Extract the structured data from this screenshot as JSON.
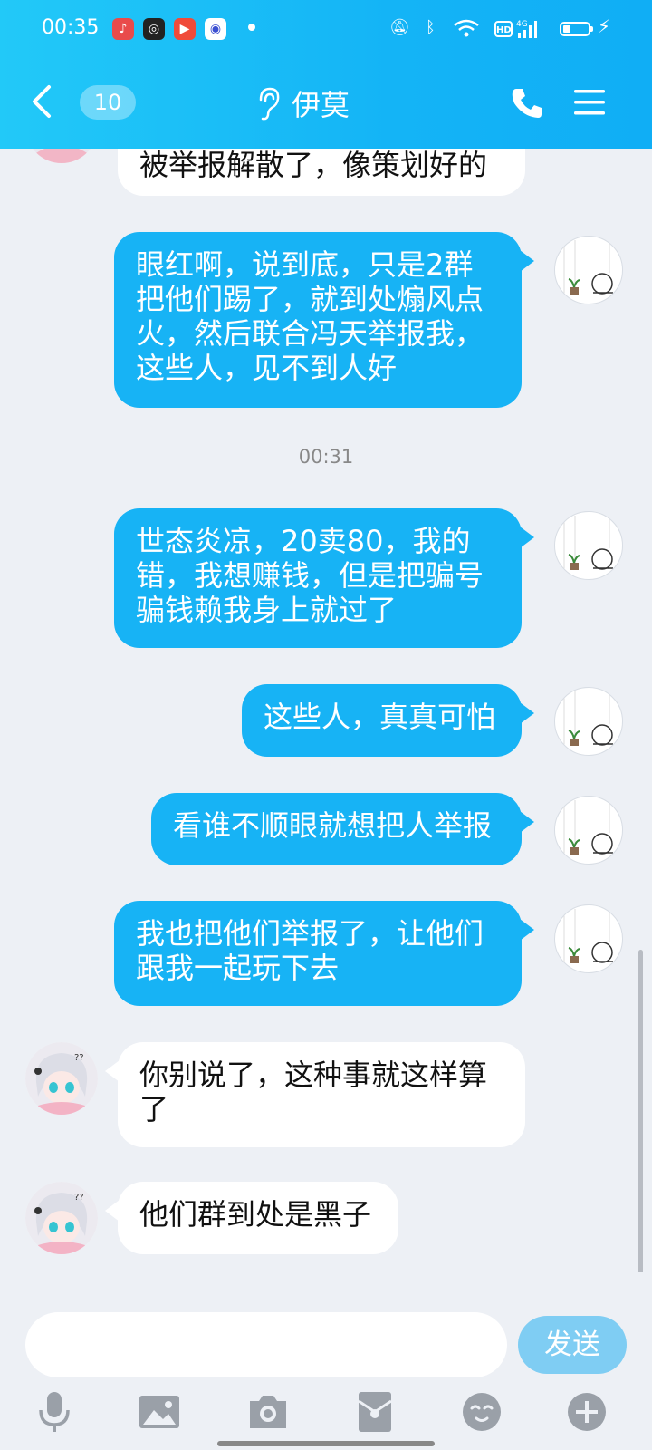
{
  "status_bar": {
    "time": "00:35",
    "network_label": "4G",
    "hd_label": "HD"
  },
  "header": {
    "unread_count": "10",
    "title": "伊莫"
  },
  "messages": [
    {
      "side": "in",
      "text": "被举报解散了，像策划好的"
    },
    {
      "side": "out",
      "text": "眼红啊，说到底，只是2群把他们踢了，就到处煽风点火，然后联合冯天举报我，这些人，见不到人好"
    },
    {
      "side": "time",
      "text": "00:31"
    },
    {
      "side": "out",
      "text": "世态炎凉，20卖80，我的错，我想赚钱，但是把骗号骗钱赖我身上就过了"
    },
    {
      "side": "out",
      "text": "这些人，真真可怕"
    },
    {
      "side": "out",
      "text": "看谁不顺眼就想把人举报"
    },
    {
      "side": "out",
      "text": "我也把他们举报了，让他们跟我一起玩下去"
    },
    {
      "side": "in",
      "text": "你别说了，这种事就这样算了"
    },
    {
      "side": "in",
      "text": "他们群到处是黑子"
    }
  ],
  "input": {
    "value": "",
    "send_label": "发送"
  },
  "toolbar": [
    "microphone-icon",
    "image-icon",
    "camera-icon",
    "red-packet-icon",
    "emoji-icon",
    "plus-icon"
  ],
  "colors": {
    "header": "#14b4f6",
    "outgoing_bubble": "#17b3f5",
    "incoming_bubble": "#ffffff",
    "send_button": "#7fcdf3",
    "background": "#edf0f5"
  }
}
